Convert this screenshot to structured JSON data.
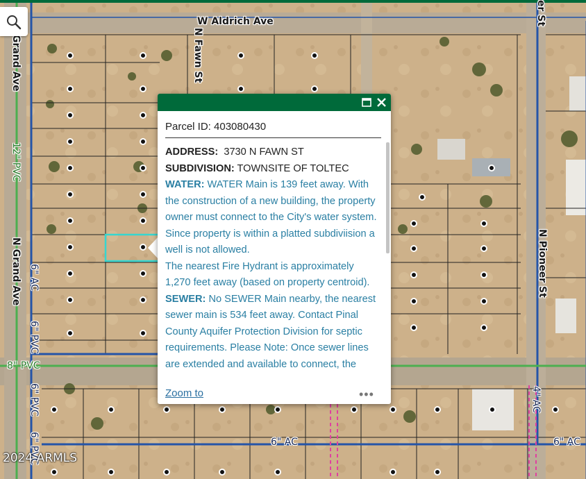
{
  "map": {
    "roads": {
      "aldrich": "W Aldrich Ave",
      "fawn": "N Fawn St",
      "grand_top": "Grand Ave",
      "grand_mid": "N Grand Ave",
      "pioneer": "N Pioneer St",
      "pioneer_top": "er St"
    },
    "pipes": {
      "pvc12": "12\" PVC",
      "pvc8": "8\" PVC",
      "pvc6_a": "6\" PVC",
      "pvc6_b": "6\" PVC",
      "pvc6_c": "6\" PVC",
      "ac6_left": "6\" AC",
      "ac6_bottom": "6\" AC",
      "ac6_right": "6\" AC",
      "ac4": "4\" AC"
    },
    "copyright": "2024 ARMLS",
    "colors": {
      "water_main": "#2454a8",
      "pvc_main": "#4caf50",
      "sewer": "#e040a0",
      "highlight": "#35d6d0"
    }
  },
  "search": {
    "icon": "search-icon"
  },
  "popup": {
    "title": "Parcel ID: 403080430",
    "maximize_icon": "maximize-icon",
    "close_icon": "close-icon",
    "address_label": "ADDRESS:",
    "address_value": "3730 N FAWN ST",
    "subdivision_label": "SUBDIVISION:",
    "subdivision_value": "TOWNSITE OF TOLTEC",
    "water_label": "WATER:",
    "water_text": "WATER Main is 139 feet away. With the construction of a new building, the property owner must connect to the City's water system.",
    "well_text": "Since property is within a platted subdiviision a well is not allowed.",
    "hydrant_text": "The nearest Fire Hydrant is approximately 1,270 feet away (based on property centroid).",
    "sewer_label": "SEWER:",
    "sewer_text": "No SEWER Main nearby, the nearest sewer main is 534 feet away. Contact Pinal County Aquifer Protection Division for septic requirements. Please Note: Once sewer lines are extended and available to connect, the",
    "zoom_label": "Zoom to",
    "more_label": "•••"
  }
}
